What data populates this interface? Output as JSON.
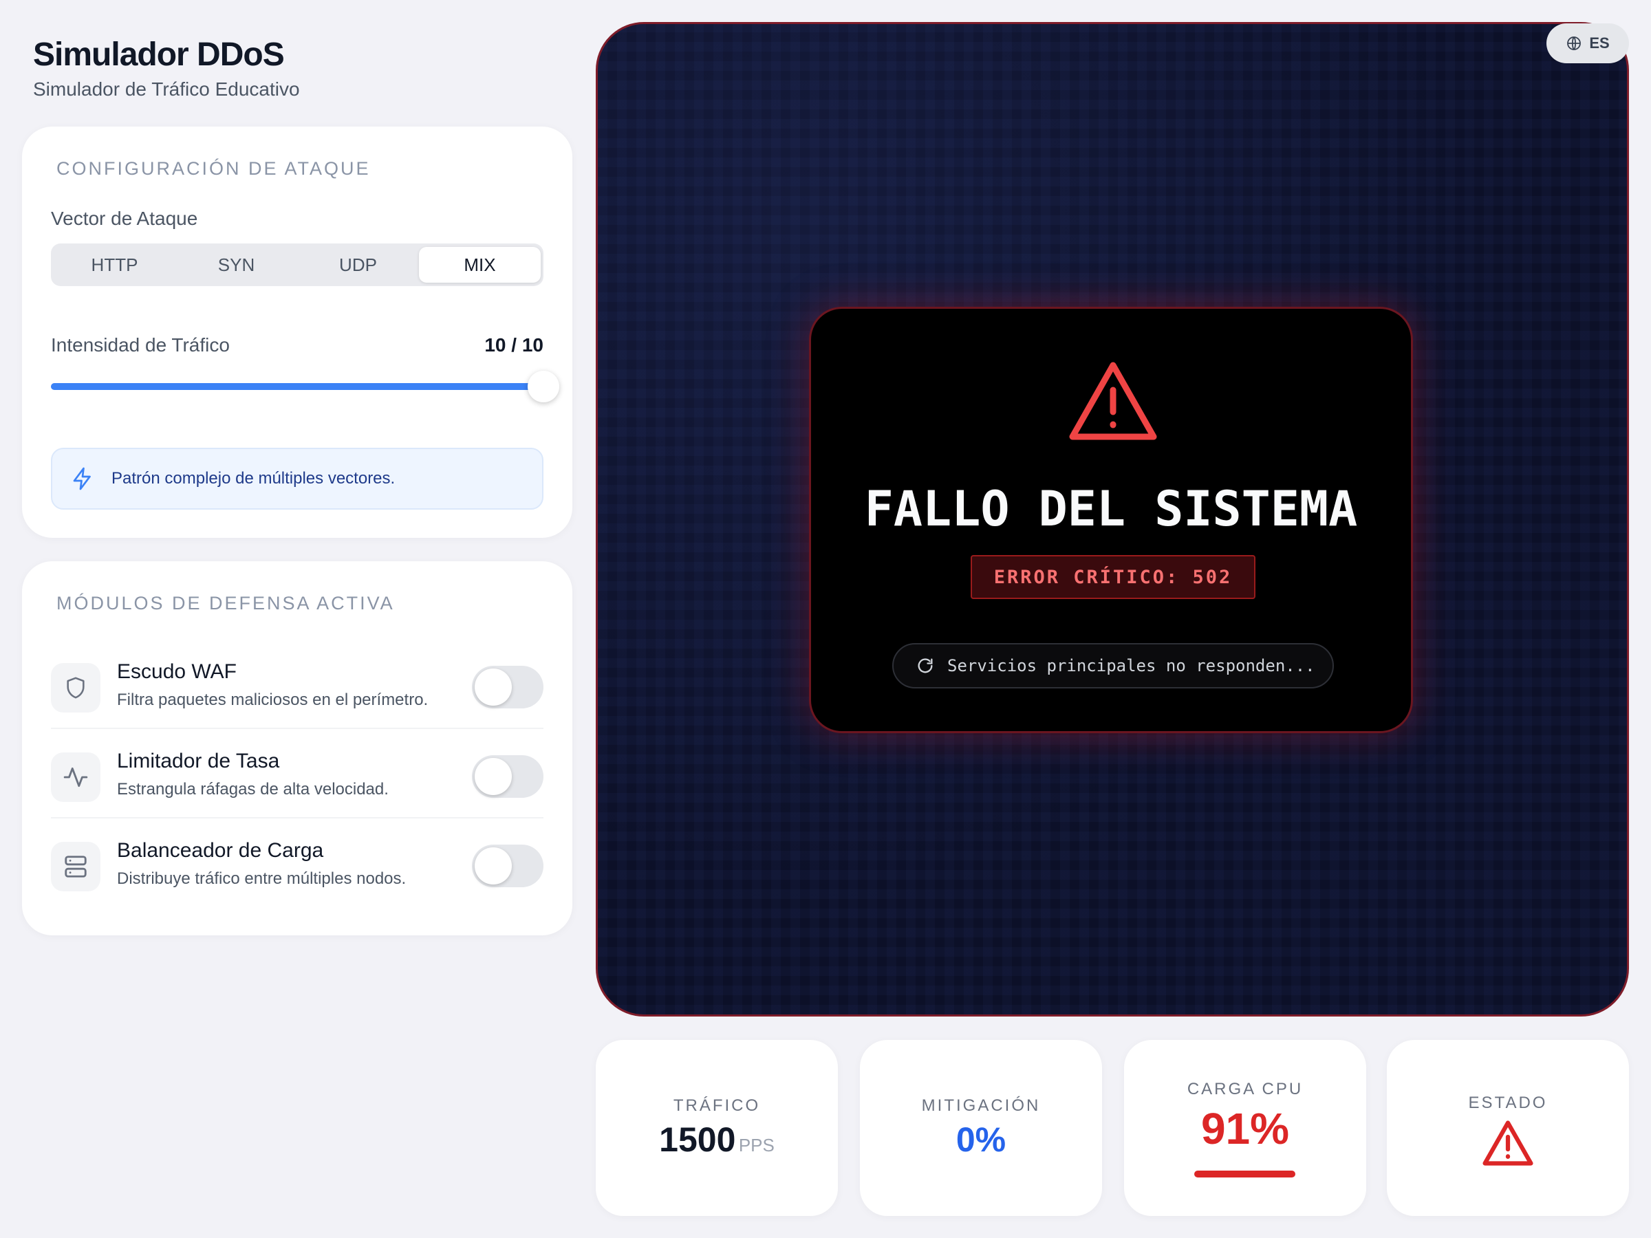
{
  "header": {
    "title": "Simulador DDoS",
    "subtitle": "Simulador de Tráfico Educativo"
  },
  "attack_config": {
    "section_title": "CONFIGURACIÓN DE ATAQUE",
    "vector_label": "Vector de Ataque",
    "vectors": [
      "HTTP",
      "SYN",
      "UDP",
      "MIX"
    ],
    "selected_vector": "MIX",
    "intensity_label": "Intensidad de Tráfico",
    "intensity_display": "10 / 10",
    "intensity_value": 10,
    "intensity_max": 10,
    "info_text": "Patrón complejo de múltiples vectores.",
    "accent_color": "#3b82f6"
  },
  "defense": {
    "section_title": "MÓDULOS DE DEFENSA ACTIVA",
    "modules": [
      {
        "name": "Escudo WAF",
        "description": "Filtra paquetes maliciosos en el perímetro.",
        "icon": "shield-icon",
        "enabled": false
      },
      {
        "name": "Limitador de Tasa",
        "description": "Estrangula ráfagas de alta velocidad.",
        "icon": "activity-icon",
        "enabled": false
      },
      {
        "name": "Balanceador de Carga",
        "description": "Distribuye tráfico entre múltiples nodos.",
        "icon": "server-icon",
        "enabled": false
      }
    ]
  },
  "language": {
    "label": "ES",
    "icon": "globe-icon"
  },
  "failure": {
    "icon": "warning-triangle-icon",
    "title": "FALLO DEL SISTEMA",
    "code": "ERROR CRÍTICO: 502",
    "status": "Servicios principales no responden...",
    "status_icon": "loading-icon",
    "color": "#ef4444"
  },
  "stats": {
    "traffic": {
      "label": "TRÁFICO",
      "value": "1500",
      "unit": "PPS"
    },
    "mitigation": {
      "label": "MITIGACIÓN",
      "value": "0%",
      "color": "#2563eb"
    },
    "cpu": {
      "label": "CARGA CPU",
      "value": "91%",
      "load_fraction": 0.91,
      "color": "#dc2626"
    },
    "status": {
      "label": "ESTADO",
      "icon": "warning-triangle-icon",
      "color": "#dc2626"
    }
  }
}
